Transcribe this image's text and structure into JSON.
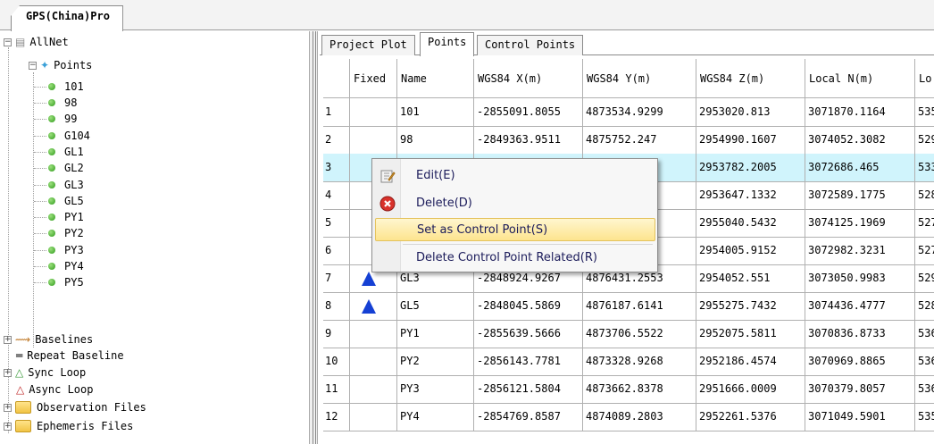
{
  "document_tab": "GPS(China)Pro",
  "tree": {
    "root": "AllNet",
    "points_label": "Points",
    "points": [
      "101",
      "98",
      "99",
      "G104",
      "GL1",
      "GL2",
      "GL3",
      "GL5",
      "PY1",
      "PY2",
      "PY3",
      "PY4",
      "PY5"
    ],
    "baselines": "Baselines",
    "repeat_baseline": "Repeat Baseline",
    "sync_loop": "Sync Loop",
    "async_loop": "Async Loop",
    "observation_files": "Observation Files",
    "ephemeris_files": "Ephemeris Files"
  },
  "tabs": [
    "Project Plot",
    "Points",
    "Control Points"
  ],
  "active_tab": "Points",
  "table": {
    "columns": [
      "",
      "Fixed",
      "Name",
      "WGS84 X(m)",
      "WGS84 Y(m)",
      "WGS84 Z(m)",
      "Local N(m)",
      "Lo"
    ],
    "rows": [
      {
        "n": "1",
        "fixed": false,
        "name": "101",
        "x": "-2855091.8055",
        "y": "4873534.9299",
        "z": "2953020.813",
        "localn": "3071870.1164",
        "loc": "535"
      },
      {
        "n": "2",
        "fixed": false,
        "name": "98",
        "x": "-2849363.9511",
        "y": "4875752.247",
        "z": "2954990.1607",
        "localn": "3074052.3082",
        "loc": "529"
      },
      {
        "n": "3",
        "fixed": false,
        "name": "",
        "x": "",
        "y": "55",
        "z": "2953782.2005",
        "localn": "3072686.465",
        "loc": "533"
      },
      {
        "n": "4",
        "fixed": false,
        "name": "",
        "x": "",
        "y": "61",
        "z": "2953647.1332",
        "localn": "3072589.1775",
        "loc": "528"
      },
      {
        "n": "5",
        "fixed": false,
        "name": "",
        "x": "",
        "y": "85",
        "z": "2955040.5432",
        "localn": "3074125.1969",
        "loc": "527"
      },
      {
        "n": "6",
        "fixed": false,
        "name": "",
        "x": "",
        "y": "18",
        "z": "2954005.9152",
        "localn": "3072982.3231",
        "loc": "527"
      },
      {
        "n": "7",
        "fixed": true,
        "name": "GL3",
        "x": "-2848924.9267",
        "y": "4876431.2553",
        "z": "2954052.551",
        "localn": "3073050.9983",
        "loc": "529"
      },
      {
        "n": "8",
        "fixed": true,
        "name": "GL5",
        "x": "-2848045.5869",
        "y": "4876187.6141",
        "z": "2955275.7432",
        "localn": "3074436.4777",
        "loc": "528"
      },
      {
        "n": "9",
        "fixed": false,
        "name": "PY1",
        "x": "-2855639.5666",
        "y": "4873706.5522",
        "z": "2952075.5811",
        "localn": "3070836.8733",
        "loc": "536"
      },
      {
        "n": "10",
        "fixed": false,
        "name": "PY2",
        "x": "-2856143.7781",
        "y": "4873328.9268",
        "z": "2952186.4574",
        "localn": "3070969.8865",
        "loc": "536"
      },
      {
        "n": "11",
        "fixed": false,
        "name": "PY3",
        "x": "-2856121.5804",
        "y": "4873662.8378",
        "z": "2951666.0009",
        "localn": "3070379.8057",
        "loc": "536"
      },
      {
        "n": "12",
        "fixed": false,
        "name": "PY4",
        "x": "-2854769.8587",
        "y": "4874089.2803",
        "z": "2952261.5376",
        "localn": "3071049.5901",
        "loc": "535"
      }
    ]
  },
  "context_menu": {
    "items": [
      "Edit(E)",
      "Delete(D)",
      "Set as Control Point(S)",
      "Delete Control Point Related(R)"
    ],
    "highlighted": "Set as Control Point(S)"
  },
  "colors": {
    "selected_row": "#d0f4fc",
    "fixed_marker": "#1540d4",
    "menu_highlight": "#fde48e",
    "point_dot": "#2e9a1a"
  }
}
